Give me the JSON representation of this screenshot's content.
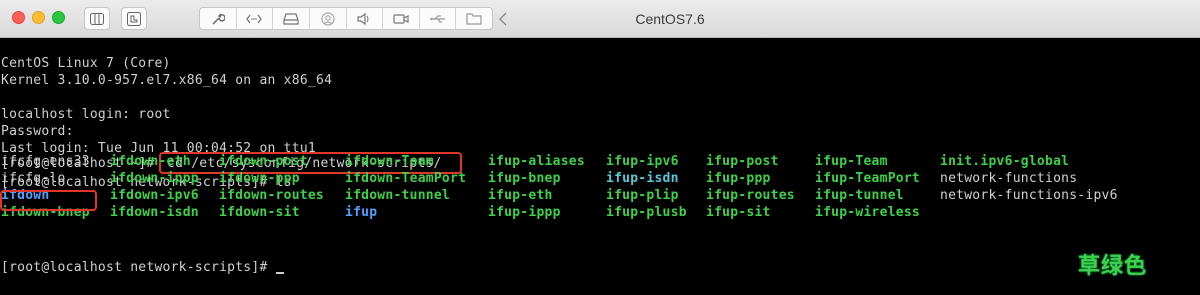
{
  "window": {
    "title": "CentOS7.6",
    "toolbar_icons": [
      "sidebar-icon",
      "snapshot-icon",
      "wrench-icon",
      "code-icon",
      "hard-disk-icon",
      "camera-icon",
      "speaker-icon",
      "video-icon",
      "usb-icon",
      "shared-folder-icon",
      "chevron-left-icon"
    ]
  },
  "terminal": {
    "lines": [
      "",
      "CentOS Linux 7 (Core)",
      "Kernel 3.10.0-957.el7.x86_64 on an x86_64",
      "",
      "localhost login: root",
      "Password:",
      "Last login: Tue Jun 11 00:04:52 on ttu1"
    ],
    "cmd1_prompt": "[root@localhost ~]#",
    "cmd1": "cd /etc/sysconfig/network-scripts/",
    "cmd2": "[root@localhost network-scripts]# ls",
    "ls_rows": [
      [
        "ifcfg-ens33",
        "ifdown-eth",
        "ifdown-post",
        "ifdown-Team",
        "ifup-aliases",
        "ifup-ipv6",
        "ifup-post",
        "ifup-Team",
        "init.ipv6-global"
      ],
      [
        "ifcfg-lo",
        "ifdown-ippp",
        "ifdown-ppp",
        "ifdown-TeamPort",
        "ifup-bnep",
        "ifup-isdn",
        "ifup-ppp",
        "ifup-TeamPort",
        "network-functions"
      ],
      [
        "ifdown",
        "ifdown-ipv6",
        "ifdown-routes",
        "ifdown-tunnel",
        "ifup-eth",
        "ifup-plip",
        "ifup-routes",
        "ifup-tunnel",
        "network-functions-ipv6"
      ],
      [
        "ifdown-bnep",
        "ifdown-isdn",
        "ifdown-sit",
        "ifup",
        "ifup-ippp",
        "ifup-plusb",
        "ifup-sit",
        "ifup-wireless",
        ""
      ]
    ],
    "ls_colors": [
      [
        "#d0d0d0",
        "#3fd14a",
        "#3fd14a",
        "#3fd14a",
        "#3fd14a",
        "#3fd14a",
        "#3fd14a",
        "#3fd14a",
        "#3fd14a"
      ],
      [
        "#d0d0d0",
        "#3fd14a",
        "#3fd14a",
        "#3fd14a",
        "#3fd14a",
        "#59c8d8",
        "#3fd14a",
        "#3fd14a",
        "#d0d0d0"
      ],
      [
        "#4fa0ff",
        "#3fd14a",
        "#3fd14a",
        "#3fd14a",
        "#3fd14a",
        "#3fd14a",
        "#3fd14a",
        "#3fd14a",
        "#d0d0d0"
      ],
      [
        "#3fd14a",
        "#3fd14a",
        "#3fd14a",
        "#4fa0ff",
        "#3fd14a",
        "#3fd14a",
        "#3fd14a",
        "#3fd14a",
        "#d0d0d0"
      ]
    ],
    "final_prompt": "[root@localhost network-scripts]# ",
    "highlight_color": "#e1372b"
  },
  "watermark": "草绿色"
}
